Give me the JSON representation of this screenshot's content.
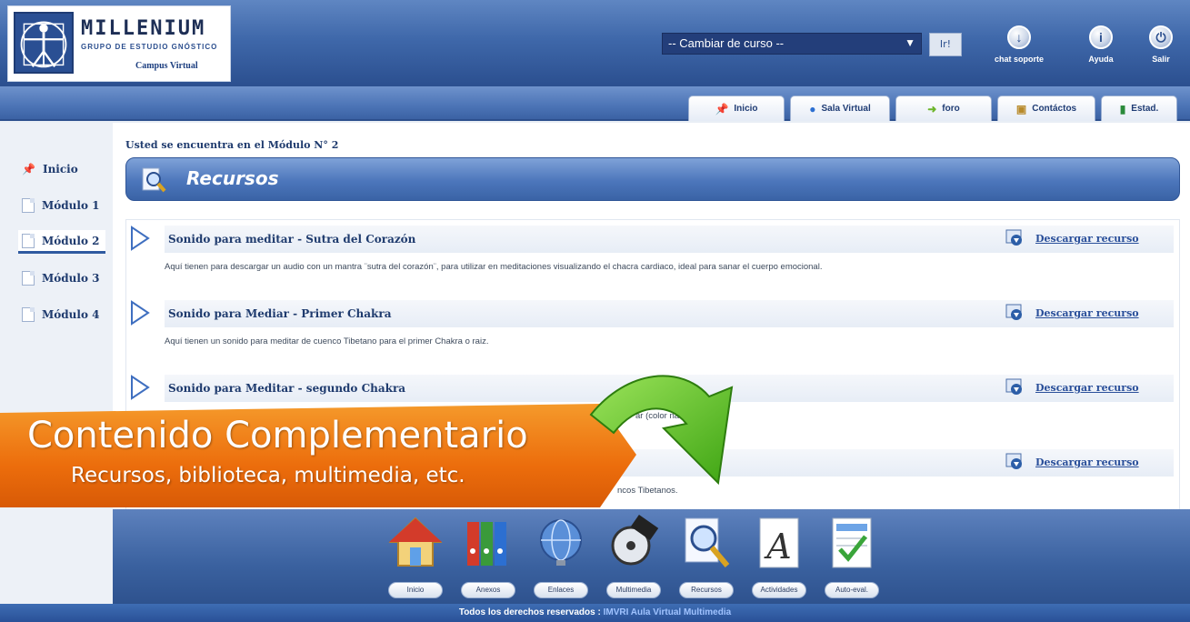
{
  "header": {
    "logo_title": "MILLENIUM",
    "logo_subtitle": "GRUPO DE ESTUDIO GNÓSTICO",
    "logo_campus": "Campus Virtual",
    "course_select_value": "-- Cambiar de curso --",
    "go_button_label": "Ir!",
    "icons": [
      {
        "name": "chat-soporte",
        "label": "chat soporte"
      },
      {
        "name": "ayuda",
        "label": "Ayuda"
      },
      {
        "name": "salir",
        "label": "Salir"
      }
    ]
  },
  "tabs": [
    {
      "label": "Inicio",
      "icon": "pin-icon"
    },
    {
      "label": "Sala Virtual",
      "icon": "chat-bubble-icon"
    },
    {
      "label": "foro",
      "icon": "arrow-icon"
    },
    {
      "label": "Contáctos",
      "icon": "contacts-icon"
    },
    {
      "label": "Estad.",
      "icon": "bar-chart-icon"
    }
  ],
  "sidebar": {
    "items": [
      {
        "label": "Inicio",
        "icon": "pin-icon",
        "active": false
      },
      {
        "label": "Módulo 1",
        "icon": "doc-icon",
        "active": false
      },
      {
        "label": "Módulo 2",
        "icon": "doc-icon",
        "active": true
      },
      {
        "label": "Módulo 3",
        "icon": "doc-icon",
        "active": false
      },
      {
        "label": "Módulo 4",
        "icon": "doc-icon",
        "active": false
      }
    ]
  },
  "main": {
    "location": "Usted se encuentra en el Módulo N° 2",
    "section_title": "Recursos",
    "download_label": "Descargar recurso",
    "resources": [
      {
        "title": "Sonido para meditar - Sutra del Corazón",
        "description": "Aquí tienen para descargar un audio con un mantra ¨sutra del corazón¨, para utilizar en meditaciones visualizando el chacra cardiaco, ideal para sanar el cuerpo emocional."
      },
      {
        "title": "Sonido para Mediar - Primer Chakra",
        "description": "Aquí tienen un sonido para meditar de cuenco Tibetano para el primer Chakra o raiz."
      },
      {
        "title": "Sonido para Meditar - segundo Chakra",
        "description": "ar (color naranja)"
      },
      {
        "title": "",
        "description": "ncos Tibetanos."
      }
    ]
  },
  "banner": {
    "main_text": "Contenido Complementario",
    "sub_text": "Recursos, biblioteca, multimedia,  etc."
  },
  "dock": {
    "items": [
      {
        "label": "Inicio",
        "icon": "house-icon"
      },
      {
        "label": "Anexos",
        "icon": "binders-icon"
      },
      {
        "label": "Enlaces",
        "icon": "globe-icon"
      },
      {
        "label": "Multimedia",
        "icon": "film-reel-icon"
      },
      {
        "label": "Recursos",
        "icon": "magnifier-icon"
      },
      {
        "label": "Actividades",
        "icon": "letter-a-icon"
      },
      {
        "label": "Auto-eval.",
        "icon": "checklist-icon"
      }
    ]
  },
  "footer": {
    "text": "Todos los derechos reservados :",
    "highlight": "IMVRI Aula Virtual Multimedia"
  },
  "colors": {
    "primary_blue": "#3f68aa",
    "dark_blue": "#1f3b6e",
    "banner_orange": "#f07a12",
    "arrow_green": "#5ec21c"
  }
}
